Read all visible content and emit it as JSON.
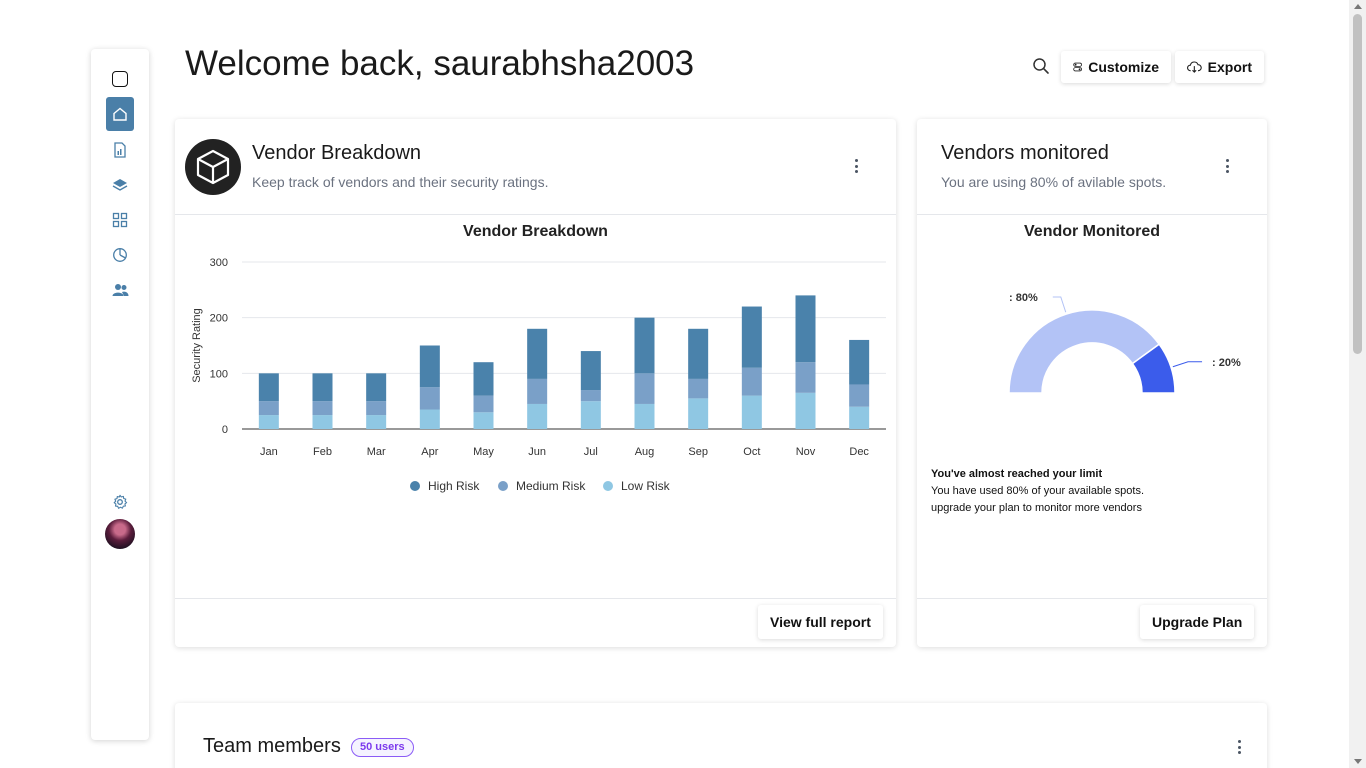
{
  "header": {
    "welcome": "Welcome back, saurabhsha2003",
    "customize_label": "Customize",
    "export_label": "Export"
  },
  "sidebar": {
    "items": [
      {
        "name": "home",
        "icon": "home-icon",
        "active": true
      },
      {
        "name": "reports",
        "icon": "report-icon",
        "active": false
      },
      {
        "name": "layers",
        "icon": "layers-icon",
        "active": false
      },
      {
        "name": "apps",
        "icon": "grid-icon",
        "active": false
      },
      {
        "name": "analytics",
        "icon": "pie-chart-icon",
        "active": false
      },
      {
        "name": "users",
        "icon": "users-icon",
        "active": false
      }
    ],
    "settings_icon": "gear-icon"
  },
  "vendor_card": {
    "title": "Vendor Breakdown",
    "subtitle": "Keep track of vendors and their security ratings.",
    "button": "View full report"
  },
  "monitor_card": {
    "title": "Vendors monitored",
    "subtitle": "You are using 80% of avilable spots.",
    "limit_title": "You've almost reached your limit",
    "limit_line1": "You have used 80% of your available spots.",
    "limit_line2": "upgrade your plan to monitor more vendors",
    "button": "Upgrade Plan"
  },
  "team_card": {
    "title": "Team members",
    "badge": "50 users"
  },
  "colors": {
    "high": "#4a82ab",
    "medium": "#7aa0c8",
    "low": "#8fc7e3",
    "gauge_used": "#b3c3f6",
    "gauge_free": "#3b5ceb",
    "accent": "#4a7fa8"
  },
  "chart_data": [
    {
      "type": "bar",
      "stacked": true,
      "title": "Vendor Breakdown",
      "xlabel": "",
      "ylabel": "Security Rating",
      "ylim": [
        0,
        300
      ],
      "yticks": [
        0,
        100,
        200,
        300
      ],
      "categories": [
        "Jan",
        "Feb",
        "Mar",
        "Apr",
        "May",
        "Jun",
        "Jul",
        "Aug",
        "Sep",
        "Oct",
        "Nov",
        "Dec"
      ],
      "series": [
        {
          "name": "High Risk",
          "values": [
            50,
            50,
            50,
            75,
            60,
            90,
            70,
            100,
            90,
            110,
            120,
            80
          ]
        },
        {
          "name": "Medium Risk",
          "values": [
            25,
            25,
            25,
            40,
            30,
            45,
            20,
            55,
            35,
            50,
            55,
            40
          ]
        },
        {
          "name": "Low Risk",
          "values": [
            25,
            25,
            25,
            35,
            30,
            45,
            50,
            45,
            55,
            60,
            65,
            40
          ]
        }
      ],
      "legend_position": "bottom",
      "grid": true
    },
    {
      "type": "pie",
      "variant": "half-donut",
      "title": "Vendor Monitored",
      "series": [
        {
          "name": "",
          "value": 80,
          "label": ": 80%"
        },
        {
          "name": "",
          "value": 20,
          "label": ": 20%"
        }
      ]
    }
  ]
}
